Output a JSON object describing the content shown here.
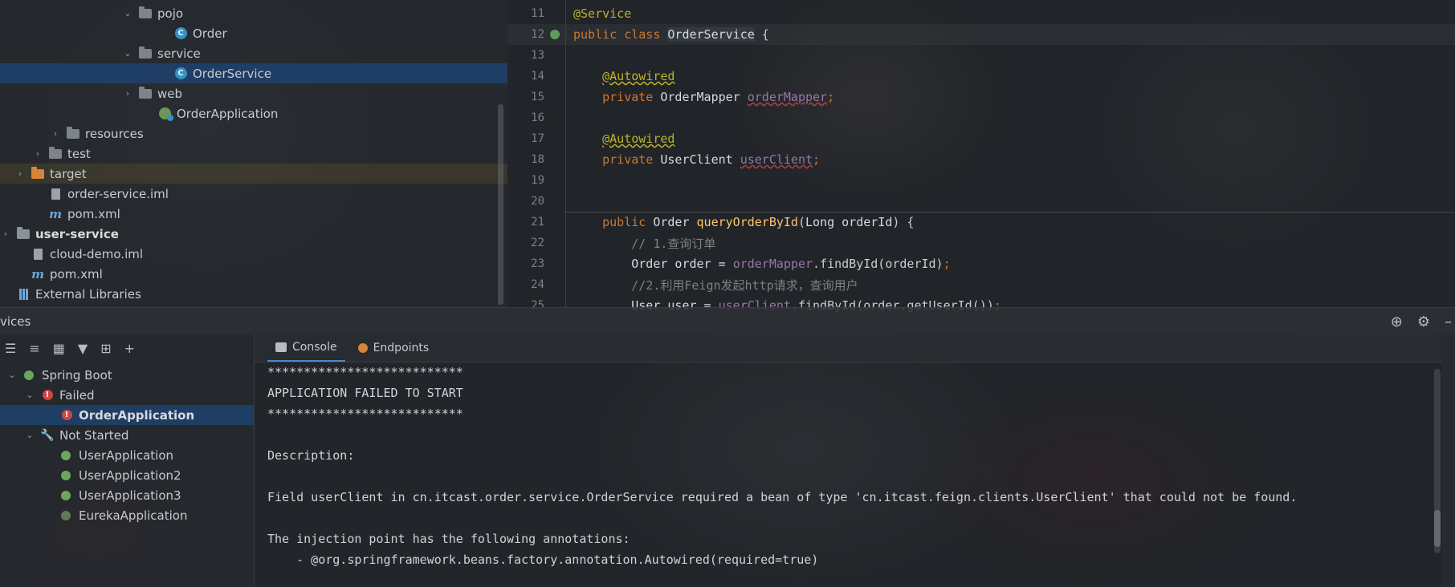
{
  "project_tree": [
    {
      "label": "pojo",
      "arrow": "⌄",
      "icon": "package",
      "indent": 152
    },
    {
      "label": "Order",
      "arrow": "",
      "icon": "class",
      "indent": 196
    },
    {
      "label": "service",
      "arrow": "⌄",
      "icon": "package",
      "indent": 152
    },
    {
      "label": "OrderService",
      "arrow": "",
      "icon": "class",
      "indent": 196
    },
    {
      "label": "web",
      "arrow": "›",
      "icon": "package",
      "indent": 152
    },
    {
      "label": "OrderApplication",
      "arrow": "",
      "icon": "spring-class",
      "indent": 176
    },
    {
      "label": "resources",
      "arrow": "›",
      "icon": "resources-folder",
      "indent": 62
    },
    {
      "label": "test",
      "arrow": "›",
      "icon": "folder",
      "indent": 40
    },
    {
      "label": "target",
      "arrow": "›",
      "icon": "target-folder",
      "indent": 18
    },
    {
      "label": "order-service.iml",
      "arrow": "",
      "icon": "iml",
      "indent": 40
    },
    {
      "label": "pom.xml",
      "arrow": "",
      "icon": "maven",
      "indent": 40
    },
    {
      "label": "user-service",
      "arrow": "›",
      "icon": "module-folder",
      "indent": 0
    },
    {
      "label": "cloud-demo.iml",
      "arrow": "",
      "icon": "iml",
      "indent": 18
    },
    {
      "label": "pom.xml",
      "arrow": "",
      "icon": "maven",
      "indent": 18
    },
    {
      "label": "External Libraries",
      "arrow": "",
      "icon": "libraries",
      "indent": 0
    }
  ],
  "editor": {
    "lines": [
      {
        "n": "11",
        "tokens": [
          [
            "ann",
            "@Service"
          ]
        ]
      },
      {
        "n": "12",
        "tokens": [
          [
            "kw",
            "public class "
          ],
          [
            "cls",
            "OrderService"
          ],
          [
            "plain",
            " {"
          ]
        ]
      },
      {
        "n": "13",
        "tokens": []
      },
      {
        "n": "14",
        "tokens": [
          [
            "plain",
            "    "
          ],
          [
            "annw",
            "@Autowired"
          ]
        ]
      },
      {
        "n": "15",
        "tokens": [
          [
            "plain",
            "    "
          ],
          [
            "kw",
            "private "
          ],
          [
            "type",
            "OrderMapper "
          ],
          [
            "ferr",
            "orderMapper"
          ],
          [
            "kw",
            ";"
          ]
        ]
      },
      {
        "n": "16",
        "tokens": []
      },
      {
        "n": "17",
        "tokens": [
          [
            "plain",
            "    "
          ],
          [
            "annw",
            "@Autowired"
          ]
        ]
      },
      {
        "n": "18",
        "tokens": [
          [
            "plain",
            "    "
          ],
          [
            "kw",
            "private "
          ],
          [
            "type",
            "UserClient "
          ],
          [
            "ferr",
            "userClient"
          ],
          [
            "kw",
            ";"
          ]
        ]
      },
      {
        "n": "19",
        "tokens": []
      },
      {
        "n": "20",
        "tokens": []
      },
      {
        "n": "21",
        "tokens": [
          [
            "plain",
            "    "
          ],
          [
            "kw",
            "public "
          ],
          [
            "type",
            "Order "
          ],
          [
            "fn",
            "queryOrderById"
          ],
          [
            "plain",
            "("
          ],
          [
            "type",
            "Long orderId"
          ],
          [
            "plain",
            ") {"
          ]
        ]
      },
      {
        "n": "22",
        "tokens": [
          [
            "plain",
            "        "
          ],
          [
            "cmt",
            "// 1.查询订单"
          ]
        ]
      },
      {
        "n": "23",
        "tokens": [
          [
            "plain",
            "        "
          ],
          [
            "type",
            "Order order = "
          ],
          [
            "field",
            "orderMapper"
          ],
          [
            "plain",
            ".findById(orderId)"
          ],
          [
            "kw",
            ";"
          ]
        ]
      },
      {
        "n": "24",
        "tokens": [
          [
            "plain",
            "        "
          ],
          [
            "cmt",
            "//2.利用Feign发起http请求，查询用户"
          ]
        ]
      },
      {
        "n": "25",
        "tokens": [
          [
            "plain",
            "        "
          ],
          [
            "type",
            "User user = "
          ],
          [
            "field",
            "userClient"
          ],
          [
            "plain",
            ".findById(order.getUserId())"
          ],
          [
            "kw",
            ";"
          ]
        ]
      }
    ]
  },
  "services": {
    "title": "vices",
    "tree": [
      {
        "label": "Spring Boot",
        "arrow": "⌄",
        "icon": "spring-boot",
        "indent": 8,
        "bold": false
      },
      {
        "label": "Failed",
        "arrow": "⌄",
        "icon": "error",
        "indent": 30,
        "bold": false
      },
      {
        "label": "OrderApplication",
        "arrow": "",
        "icon": "error",
        "indent": 74,
        "bold": true
      },
      {
        "label": "Not Started",
        "arrow": "⌄",
        "icon": "wrench",
        "indent": 30,
        "bold": false
      },
      {
        "label": "UserApplication",
        "arrow": "",
        "icon": "spring-boot",
        "indent": 74,
        "bold": false
      },
      {
        "label": "UserApplication2",
        "arrow": "",
        "icon": "spring-boot",
        "indent": 74,
        "bold": false
      },
      {
        "label": "UserApplication3",
        "arrow": "",
        "icon": "spring-boot",
        "indent": 74,
        "bold": false
      },
      {
        "label": "EurekaApplication",
        "arrow": "",
        "icon": "spring-boot-dim",
        "indent": 74,
        "bold": false
      }
    ]
  },
  "console": {
    "tabs": [
      {
        "label": "Console",
        "active": true
      },
      {
        "label": "Endpoints",
        "active": false
      }
    ],
    "output": [
      "***************************",
      "APPLICATION FAILED TO START",
      "***************************",
      "",
      "Description:",
      "",
      "Field userClient in cn.itcast.order.service.OrderService required a bean of type 'cn.itcast.feign.clients.UserClient' that could not be found.",
      "",
      "The injection point has the following annotations:",
      "    - @org.springframework.beans.factory.annotation.Autowired(required=true)"
    ]
  }
}
